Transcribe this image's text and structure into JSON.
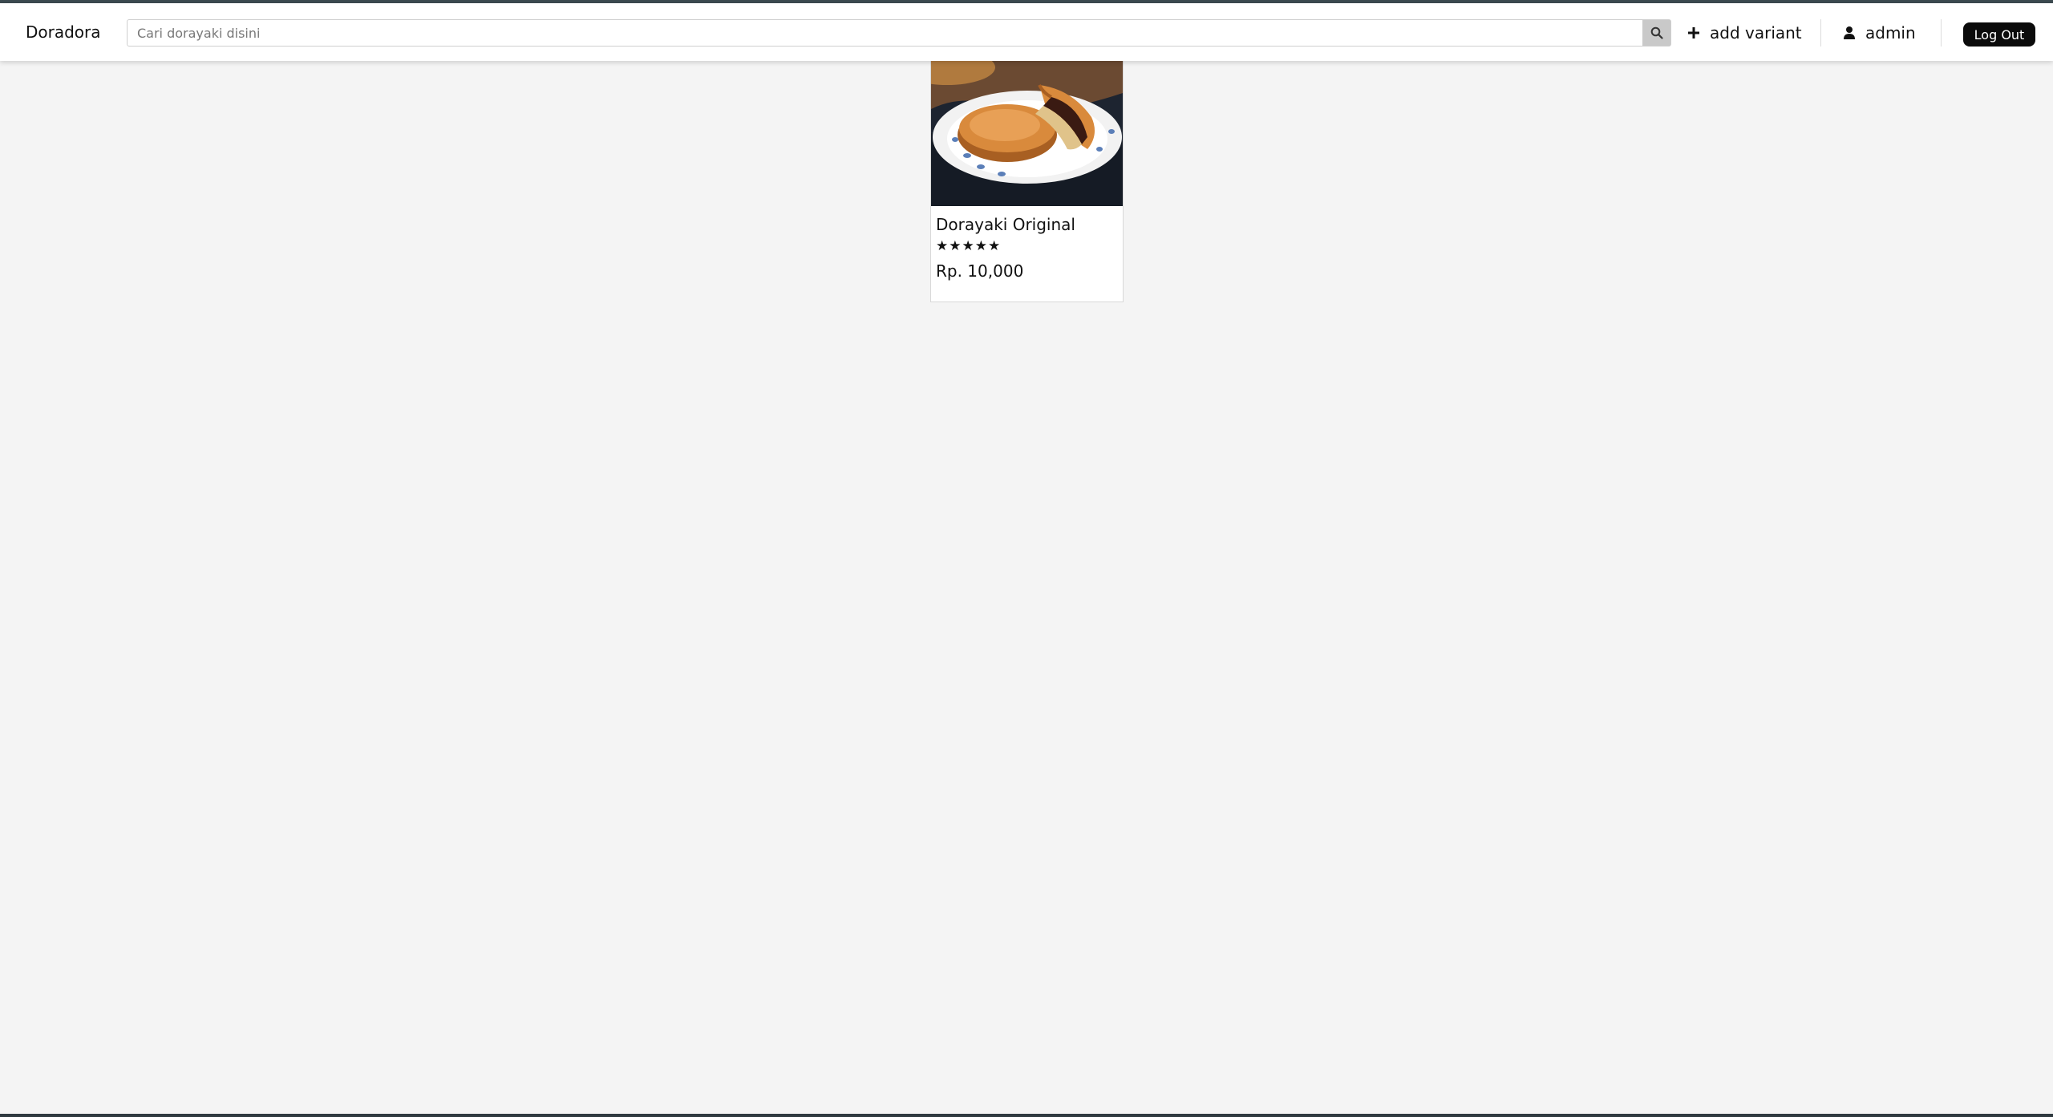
{
  "header": {
    "brand": "Doradora",
    "search": {
      "placeholder": "Cari dorayaki disini",
      "value": ""
    },
    "add_variant_label": "add variant",
    "user_label": "admin",
    "logout_label": "Log Out"
  },
  "products": [
    {
      "name": "Dorayaki Original",
      "rating_stars": "★★★★★",
      "rating_value": 5,
      "price": "Rp. 10,000"
    }
  ],
  "icons": {
    "search": "search-icon",
    "add": "plus-icon",
    "user": "user-icon"
  },
  "colors": {
    "page_background": "#f4f4f4",
    "navbar_background": "#ffffff",
    "logout_background": "#0b0b0b",
    "search_button_background": "#c9c9c9"
  }
}
